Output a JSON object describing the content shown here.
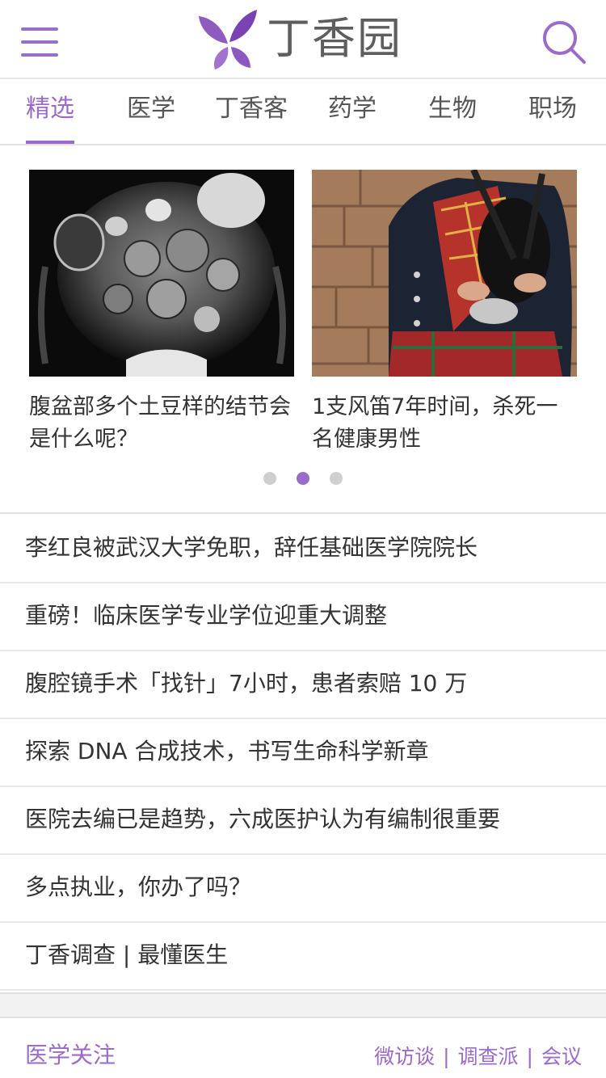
{
  "header": {
    "logo_text": "丁香园",
    "menu_icon": "hamburger-menu-icon",
    "search_icon": "search-icon"
  },
  "colors": {
    "accent": "#9a6bc9",
    "text": "#333333",
    "divider": "#e6e6e6"
  },
  "tabs": [
    {
      "label": "精选",
      "active": true
    },
    {
      "label": "医学"
    },
    {
      "label": "丁香客"
    },
    {
      "label": "药学"
    },
    {
      "label": "生物"
    },
    {
      "label": "职场"
    }
  ],
  "carousel": {
    "cards": [
      {
        "title": "腹盆部多个土豆样的结节会是什么呢？"
      },
      {
        "title": "1支风笛7年时间，杀死一名健康男性"
      }
    ],
    "active_dot": 2,
    "dot_count": 3
  },
  "news": [
    "李红良被武汉大学免职，辞任基础医学院院长",
    "重磅！临床医学专业学位迎重大调整",
    "腹腔镜手术「找针」7小时，患者索赔 10 万",
    "探索 DNA 合成技术，书写生命科学新章",
    "医院去编已是趋势，六成医护认为有编制很重要",
    "多点执业，你办了吗？",
    "丁香调查 | 最懂医生"
  ],
  "footer": {
    "title": "医学关注",
    "links": [
      "微访谈",
      "调查派",
      "会议"
    ]
  }
}
